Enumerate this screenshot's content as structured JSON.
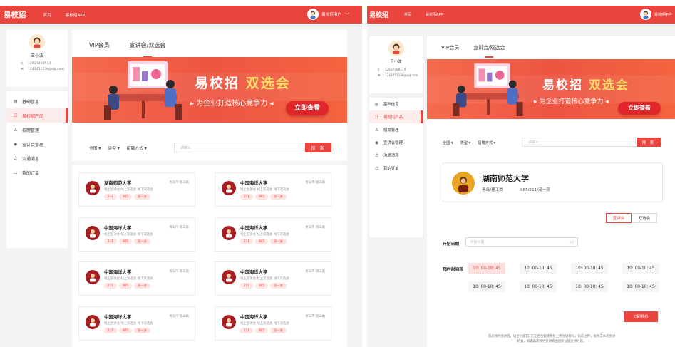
{
  "app": {
    "logo": "易校招",
    "nav": [
      "首页",
      "易校招APP"
    ],
    "user": "易校招用户",
    "user_chevron": "﹀"
  },
  "profile": {
    "name": "王小波",
    "phone": "12637488574",
    "email": "1243451238@qq.com"
  },
  "menu": [
    {
      "label": "基础信息",
      "icon": "file-icon",
      "glyph": "▤"
    },
    {
      "label": "易校招产品",
      "icon": "grid-icon",
      "glyph": "☷",
      "active": true
    },
    {
      "label": "招聘管理",
      "icon": "person-icon",
      "glyph": "♙"
    },
    {
      "label": "宣讲会管理",
      "icon": "eye-icon",
      "glyph": "◉"
    },
    {
      "label": "沟通消息",
      "icon": "bell-icon",
      "glyph": "♫"
    },
    {
      "label": "我的订单",
      "icon": "order-icon",
      "glyph": "▭"
    }
  ],
  "tabs": [
    "VIP会员",
    "宣讲会/双选会"
  ],
  "active_tab": 1,
  "banner": {
    "title_a": "易",
    "title_b": "校招",
    "title_c": "双选会",
    "subtitle": "▸ 为企业打造核心竞争力 ◂",
    "cta": "立即查看"
  },
  "filters": {
    "items": [
      "全国 ▾",
      "类型 ▾",
      "招聘方式 ▾"
    ],
    "search_placeholder": "请输入",
    "search_button": "搜 索"
  },
  "universities": [
    {
      "name": "湖南师范大学",
      "location": "青岛市  理工类",
      "modes": "线上宣讲会  线上双选会  线下双选会",
      "tags": [
        "211",
        "985",
        "双一流"
      ]
    },
    {
      "name": "中国海洋大学",
      "location": "青岛市  理工类",
      "modes": "线上宣讲会  线上双选会  线下双选会",
      "tags": [
        "211",
        "985",
        "双一流"
      ]
    },
    {
      "name": "中国海洋大学",
      "location": "青岛市  理工类",
      "modes": "线上宣讲会  线上双选会  线下双选会",
      "tags": [
        "211",
        "985",
        "双一流"
      ]
    },
    {
      "name": "中国海洋大学",
      "location": "青岛市  理工类",
      "modes": "线上宣讲会  线上双选会  线下双选会",
      "tags": [
        "211",
        "985",
        "双一流"
      ]
    },
    {
      "name": "中国海洋大学",
      "location": "青岛市  理工类",
      "modes": "线上宣讲会  线上双选会  线下双选会",
      "tags": [
        "211",
        "985",
        "双一流"
      ]
    },
    {
      "name": "中国海洋大学",
      "location": "青岛市  理工类",
      "modes": "线上宣讲会  线上双选会  线下双选会",
      "tags": [
        "211",
        "985",
        "双一流"
      ]
    },
    {
      "name": "中国海洋大学",
      "location": "青岛市  理工类",
      "modes": "线上宣讲会  线上双选会  线下双选会",
      "tags": [
        "211",
        "985",
        "双一流"
      ]
    },
    {
      "name": "中国海洋大学",
      "location": "青岛市  理工类",
      "modes": "线上宣讲会  线上双选会  线下双选会",
      "tags": [
        "211",
        "985",
        "双一流"
      ]
    }
  ],
  "detail": {
    "name": "湖南师范大学",
    "location": "青岛/理工类",
    "level": "985/211/双一流",
    "segments": [
      "宣讲会",
      "双选会"
    ],
    "start_date_label": "开始日期",
    "date_placeholder": "开始日期",
    "time_label": "预约时间段",
    "slots": [
      "10: 00-10: 45",
      "10: 00-10: 45",
      "10: 00-10: 45",
      "10: 00-10: 45",
      "10: 00-10: 45",
      "10: 00-10: 45",
      "10: 00-10: 45",
      "10: 00-10: 45"
    ],
    "book_button": "立即预约",
    "note_line1": "首次预约宣讲后，请至少提前3天在后台管理系统上传宣讲资料，如未上传，很失去本次宣讲",
    "note_line2": "机会，如遇再次预约宣讲将由组织分配宣讲时段。"
  },
  "colors": {
    "brand": "#e9443d",
    "banner": "#f0583f",
    "tag_bg": "#fde3e1"
  }
}
